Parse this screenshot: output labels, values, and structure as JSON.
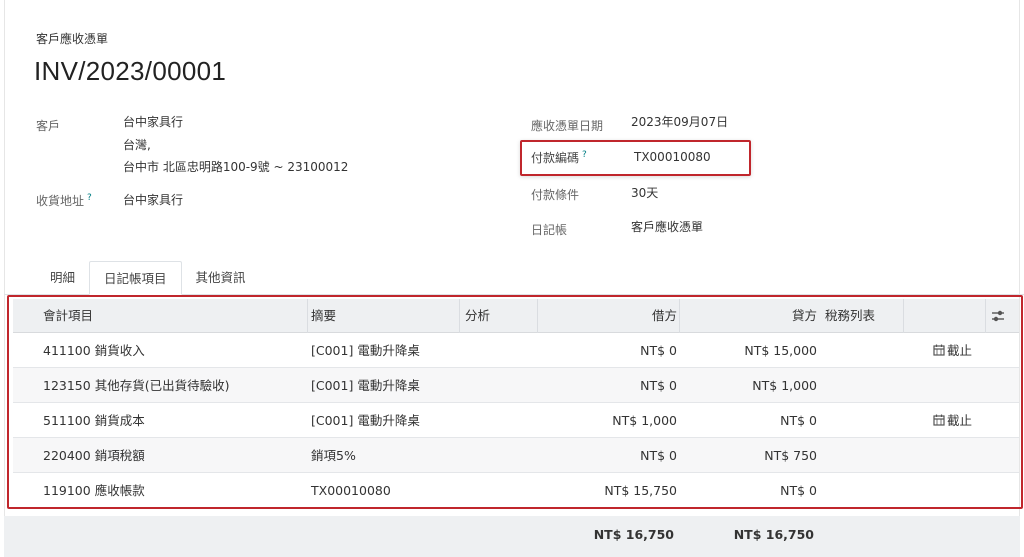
{
  "header": {
    "doc_type": "客戶應收憑單",
    "title": "INV/2023/00001"
  },
  "left_fields": {
    "customer_label": "客戶",
    "customer_name": "台中家具行",
    "customer_addr1": "台灣,",
    "customer_addr2": "台中市 北區忠明路100-9號 ~ 23100012",
    "delivery_label": "收貨地址",
    "delivery_help": "?",
    "delivery_value": "台中家具行"
  },
  "right_fields": {
    "invoice_date_label": "應收憑單日期",
    "invoice_date_value": "2023年09月07日",
    "payment_ref_label": "付款編碼",
    "payment_ref_help": "?",
    "payment_ref_value": "TX00010080",
    "payment_terms_label": "付款條件",
    "payment_terms_value": "30天",
    "journal_label": "日記帳",
    "journal_value": "客戶應收憑單"
  },
  "tabs": [
    {
      "label": "明細",
      "active": false
    },
    {
      "label": "日記帳項目",
      "active": true
    },
    {
      "label": "其他資訊",
      "active": false
    }
  ],
  "table": {
    "columns": {
      "account": "會計項目",
      "label": "摘要",
      "analytic": "分析",
      "debit": "借方",
      "credit": "貸方",
      "taxes": "稅務列表"
    },
    "rows": [
      {
        "account": "411100 銷貨收入",
        "label": "[C001] 電動升降桌",
        "debit": "NT$ 0",
        "credit": "NT$ 15,000",
        "tag": "截止"
      },
      {
        "account": "123150 其他存貨(已出貨待驗收)",
        "label": "[C001] 電動升降桌",
        "debit": "NT$ 0",
        "credit": "NT$ 1,000",
        "tag": ""
      },
      {
        "account": "511100 銷貨成本",
        "label": "[C001] 電動升降桌",
        "debit": "NT$ 1,000",
        "credit": "NT$ 0",
        "tag": "截止"
      },
      {
        "account": "220400 銷項稅額",
        "label": "銷項5%",
        "debit": "NT$ 0",
        "credit": "NT$ 750",
        "tag": ""
      },
      {
        "account": "119100 應收帳款",
        "label": "TX00010080",
        "debit": "NT$ 15,750",
        "credit": "NT$ 0",
        "tag": ""
      }
    ],
    "totals": {
      "debit": "NT$ 16,750",
      "credit": "NT$ 16,750"
    }
  },
  "icons": {
    "calendar": "calendar-icon",
    "adjust": "sliders-icon"
  },
  "colors": {
    "highlight": "#c0262c",
    "help": "#017e84",
    "header_bg": "#eef0f2"
  }
}
